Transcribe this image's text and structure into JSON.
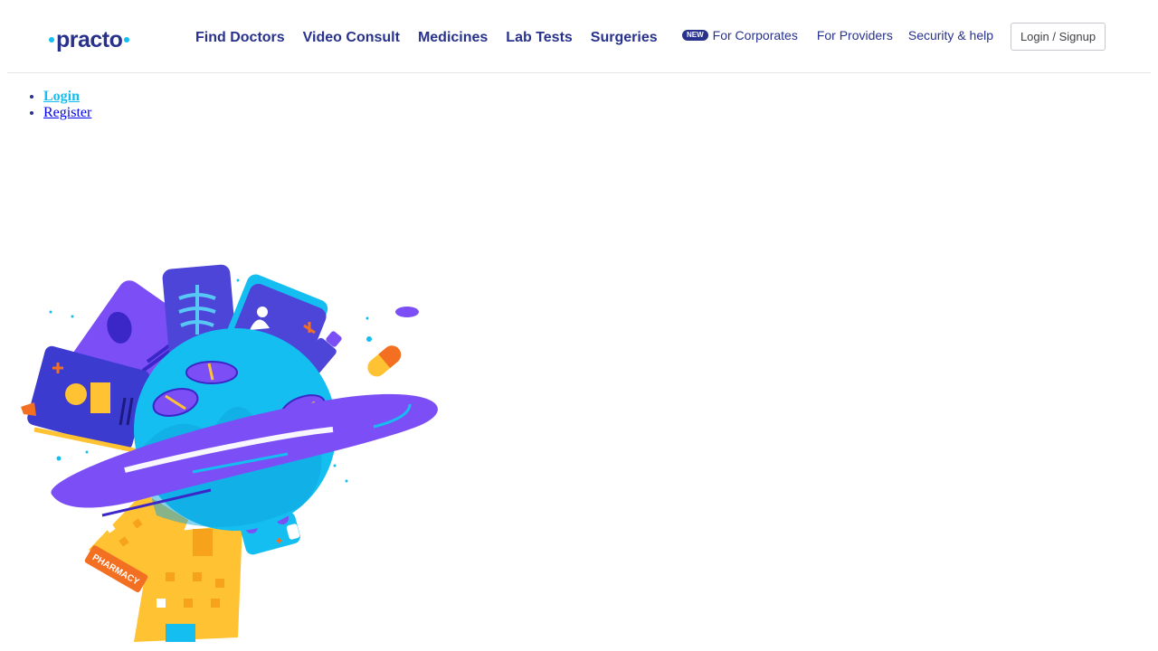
{
  "brand": {
    "name": "practo"
  },
  "nav_main": [
    {
      "label": "Find Doctors"
    },
    {
      "label": "Video Consult"
    },
    {
      "label": "Medicines"
    },
    {
      "label": "Lab Tests"
    },
    {
      "label": "Surgeries"
    }
  ],
  "nav_secondary": {
    "new_badge": "NEW",
    "corporates": "For Corporates",
    "providers": "For Providers",
    "security": "Security & help"
  },
  "login_button": "Login / Signup",
  "auth_links": [
    {
      "label": "Login"
    },
    {
      "label": "Register"
    }
  ],
  "illustration": {
    "sign_text": "PHARMACY"
  },
  "colors": {
    "brand_navy": "#28328c",
    "brand_cyan": "#14bef0",
    "purple": "#7b4ff5",
    "yellow": "#ffc233",
    "orange": "#f36f21"
  }
}
